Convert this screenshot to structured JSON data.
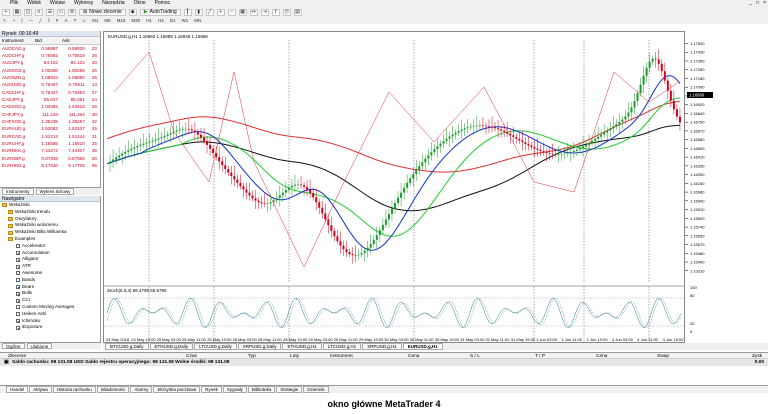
{
  "menu": {
    "items": [
      "Plik",
      "Widok",
      "Wstaw",
      "Wykresy",
      "Narzędzia",
      "Okno",
      "Pomoc"
    ]
  },
  "toolbar": {
    "new_order": "Nowe zlecenie",
    "autotrading": "AutoTrading",
    "timeframes": [
      "M1",
      "M5",
      "M15",
      "M30",
      "H1",
      "H4",
      "D1",
      "W1",
      "MN"
    ]
  },
  "market_watch": {
    "title": "Rynek: 00:16:49",
    "columns": [
      "Instrument",
      "Bid",
      "Ask",
      ""
    ],
    "rows": [
      {
        "symbol": "AUDCAD.g",
        "bid": "0.98897",
        "ask": "0.98920",
        "spread": "23"
      },
      {
        "symbol": "AUDCHF.g",
        "bid": "0.75592",
        "ask": "0.75618",
        "spread": "26"
      },
      {
        "symbol": "AUDJPY.g",
        "bid": "84.102",
        "ask": "84.122",
        "spread": "20"
      },
      {
        "symbol": "AUDSGD.g",
        "bid": "1.00260",
        "ask": "1.00285",
        "spread": "25"
      },
      {
        "symbol": "AUDNZD.g",
        "bid": "1.08834",
        "ask": "1.08860",
        "spread": "26"
      },
      {
        "symbol": "AUDUSD.g",
        "bid": "0.76497",
        "ask": "0.76511",
        "spread": "14"
      },
      {
        "symbol": "CADCHF.g",
        "bid": "0.76427",
        "ask": "0.76454",
        "spread": "27"
      },
      {
        "symbol": "CADJPY.g",
        "bid": "85.027",
        "ask": "85.051",
        "spread": "24"
      },
      {
        "symbol": "CADSGD.g",
        "bid": "1.03392",
        "ask": "1.03418",
        "spread": "26"
      },
      {
        "symbol": "CHFJPY.g",
        "bid": "111.234",
        "ask": "111.264",
        "spread": "30"
      },
      {
        "symbol": "CHFSGD.g",
        "bid": "1.35235",
        "ask": "1.35287",
        "spread": "32"
      },
      {
        "symbol": "EURAUD.g",
        "bid": "1.52082",
        "ask": "1.52107",
        "spread": "25"
      },
      {
        "symbol": "EURCAD.g",
        "bid": "1.51213",
        "ask": "1.51244",
        "spread": "31"
      },
      {
        "symbol": "EURCHF.g",
        "bid": "1.15585",
        "ask": "1.15610",
        "spread": "25"
      },
      {
        "symbol": "EURDKK.g",
        "bid": "7.44272",
        "ask": "7.44307",
        "spread": "35"
      },
      {
        "symbol": "EURGBP.g",
        "bid": "0.87846",
        "ask": "0.87866",
        "spread": "20"
      },
      {
        "symbol": "EURHKD.g",
        "bid": "9.17640",
        "ask": "9.17705",
        "spread": "65"
      }
    ],
    "tabs": [
      "Instrumenty",
      "Wykres tickowy"
    ]
  },
  "navigator": {
    "title": "Nawigator",
    "items": [
      {
        "label": "Wskaźniki",
        "level": 0,
        "icon": "folder-icon"
      },
      {
        "label": "Wskaźniki trendu",
        "level": 1,
        "icon": "folder-icon"
      },
      {
        "label": "Oscylatory",
        "level": 1,
        "icon": "folder-icon"
      },
      {
        "label": "Wskaźniki wolumenu",
        "level": 1,
        "icon": "folder-icon"
      },
      {
        "label": "Wskaźniki Billa Williamsa",
        "level": 1,
        "icon": "folder-icon"
      },
      {
        "label": "Examples",
        "level": 1,
        "icon": "folder-icon"
      },
      {
        "label": "Accelerator",
        "level": 2,
        "icon": "indicator-icon"
      },
      {
        "label": "Accumulation",
        "level": 2,
        "icon": "indicator-icon"
      },
      {
        "label": "Alligator",
        "level": 2,
        "icon": "indicator-icon"
      },
      {
        "label": "ATR",
        "level": 2,
        "icon": "indicator-icon"
      },
      {
        "label": "Awesome",
        "level": 2,
        "icon": "indicator-icon"
      },
      {
        "label": "Bands",
        "level": 2,
        "icon": "indicator-icon"
      },
      {
        "label": "Bears",
        "level": 2,
        "icon": "indicator-icon"
      },
      {
        "label": "Bulls",
        "level": 2,
        "icon": "indicator-icon"
      },
      {
        "label": "CCI",
        "level": 2,
        "icon": "indicator-icon"
      },
      {
        "label": "Custom Moving Averages",
        "level": 2,
        "icon": "indicator-icon"
      },
      {
        "label": "Heiken Ashi",
        "level": 2,
        "icon": "indicator-icon"
      },
      {
        "label": "Ichimoku",
        "level": 2,
        "icon": "indicator-icon"
      },
      {
        "label": "iExposure",
        "level": 2,
        "icon": "indicator-icon"
      }
    ],
    "tabs": [
      "Ogólne",
      "Ulubione"
    ]
  },
  "chart": {
    "header": "EURUSD.g,H1  1.16960 1.16988 1.16946 1.16966",
    "stoch_label": "Stoch(5,3,3) 66.4796 65.5790",
    "current_price": "1.16966",
    "price_labels": [
      "1.17520",
      "1.17430",
      "1.17350",
      "1.17260",
      "1.17180",
      "1.17090",
      "1.17010",
      "1.16920",
      "1.16840",
      "1.16750",
      "1.16670",
      "1.16580",
      "1.16500",
      "1.16410",
      "1.16330",
      "1.16250",
      "1.16160",
      "1.16080",
      "1.15990",
      "1.15910",
      "1.15820",
      "1.15740",
      "1.15650",
      "1.15570",
      "1.15480",
      "1.15400",
      "1.15310"
    ],
    "stoch_labels": [
      "100",
      "80",
      "20",
      "0"
    ],
    "time_labels": [
      "24 May 2018",
      "24 May 19:00",
      "25 May 03:00",
      "25 May 11:00",
      "25 May 19:00",
      "28 May 03:00",
      "28 May 11:00",
      "28 May 19:00",
      "29 May 03:00",
      "29 May 11:00",
      "29 May 19:00",
      "30 May 03:00",
      "30 May 11:00",
      "30 May 19:00",
      "31 May 03:00",
      "31 May 11:00",
      "31 May 19:00",
      "1 Jun 03:00",
      "1 Jun 11:00",
      "1 Jun 19:00",
      "4 Jun 03:00",
      "4 Jun 11:00",
      "4 Jun 19:00"
    ],
    "tabs": [
      "BTCUSD.g,Daily",
      "ETHUSD.g,Daily",
      "LTCUSD.g,Daily",
      "XRPUSD.g,Daily",
      "ETHUSD.g,H1",
      "LTCUSD.g,H1",
      "XRPUSD.g,H1",
      "EURUSD.g,H1"
    ],
    "active_tab": "EURUSD.g,H1",
    "colors": {
      "bull": "#1a9c2a",
      "bear": "#d0021b",
      "ma_red": "#e03030",
      "ma_black": "#111111",
      "ma_green": "#22cc33",
      "ma_blue": "#1030d0"
    }
  },
  "terminal": {
    "columns": [
      "Zlecenie",
      "Czas",
      "Typ",
      "Loty",
      "Instrument",
      "Cena",
      "S / L",
      "T / P",
      "Cena",
      "Swap",
      "Zysk"
    ],
    "balance_line": "Saldo rachunku: 98 131.08 USD  Saldo rejestru operacyjnego: 98 131.08  Wolne środki: 98 131.08",
    "balance_value": "0.00",
    "tabs": [
      "Handel",
      "Aktywa",
      "Historia rachunku",
      "Wiadomości",
      "Alarmy",
      "Skrzynka pocztowa",
      "Rynek",
      "Sygnały",
      "Biblioteka",
      "Strategie",
      "Dziennik"
    ]
  },
  "caption": "okno główne MetaTrader 4"
}
